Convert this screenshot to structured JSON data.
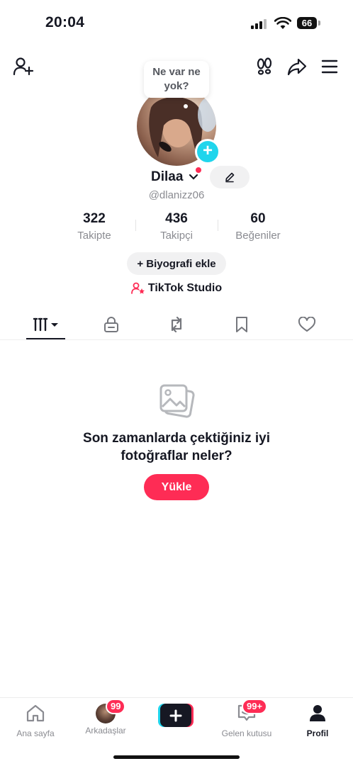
{
  "status_bar": {
    "time": "20:04",
    "battery": "66"
  },
  "header": {
    "add_friend_icon": "person-plus-icon",
    "footprints_icon": "footprints-icon",
    "share_icon": "share-arrow-icon",
    "menu_icon": "hamburger-menu-icon"
  },
  "profile": {
    "bubble_text": "Ne var ne yok?",
    "display_name": "Dilaa",
    "username": "@dlanizz06",
    "stats": [
      {
        "value": "322",
        "label": "Takipte"
      },
      {
        "value": "436",
        "label": "Takipçi"
      },
      {
        "value": "60",
        "label": "Beğeniler"
      }
    ],
    "bio_button": "+ Biyografi ekle",
    "studio_link": "TikTok Studio"
  },
  "tabs": [
    {
      "icon": "grid-videos-icon",
      "active": true
    },
    {
      "icon": "lock-icon"
    },
    {
      "icon": "repost-icon"
    },
    {
      "icon": "bookmark-icon"
    },
    {
      "icon": "heart-icon"
    }
  ],
  "empty_state": {
    "line1": "Son zamanlarda çektiğiniz iyi",
    "line2": "fotoğraflar neler?",
    "upload_button": "Yükle"
  },
  "bottom_nav": {
    "home": "Ana sayfa",
    "friends": "Arkadaşlar",
    "friends_badge": "99",
    "inbox": "Gelen kutusu",
    "inbox_badge": "99+",
    "profile": "Profil"
  },
  "colors": {
    "accent": "#fe2c55",
    "cyan": "#20d5ec",
    "text": "#161823",
    "muted": "#8a8b91"
  }
}
